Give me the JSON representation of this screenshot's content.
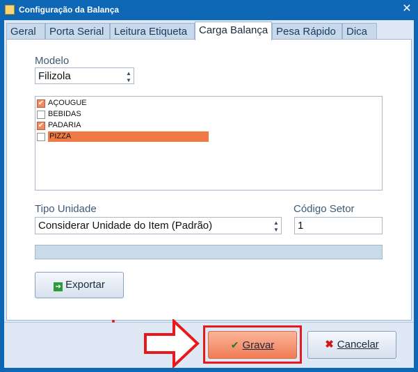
{
  "window": {
    "title": "Configuração da Balança",
    "close_glyph": "✕"
  },
  "tabs": [
    {
      "label": "Geral"
    },
    {
      "label": "Porta Serial"
    },
    {
      "label": "Leitura Etiqueta"
    },
    {
      "label": "Carga Balança",
      "active": true
    },
    {
      "label": "Pesa Rápido"
    },
    {
      "label": "Dica"
    }
  ],
  "form": {
    "modelo_label": "Modelo",
    "modelo_value": "Filizola",
    "setores": [
      {
        "label": "AÇOUGUE",
        "checked": true
      },
      {
        "label": "BEBIDAS",
        "checked": false
      },
      {
        "label": "PADARIA",
        "checked": true
      },
      {
        "label": "PIZZA",
        "checked": false,
        "selected": true
      }
    ],
    "tipo_unidade_label": "Tipo Unidade",
    "tipo_unidade_value": "Considerar Unidade do Item (Padrão)",
    "codigo_setor_label": "Código Setor",
    "codigo_setor_value": "1",
    "progress": 0,
    "exportar_label": "Exportar"
  },
  "footer": {
    "gravar_label": "Gravar",
    "cancelar_label": "Cancelar"
  },
  "colors": {
    "titlebar": "#0d67b5",
    "selection": "#f07a45",
    "annotation": "#e8191d"
  },
  "icons": {
    "export": "export-arrow-icon",
    "gravar": "check-icon",
    "cancelar": "x-icon",
    "annotation": "red-arrow-icon"
  }
}
